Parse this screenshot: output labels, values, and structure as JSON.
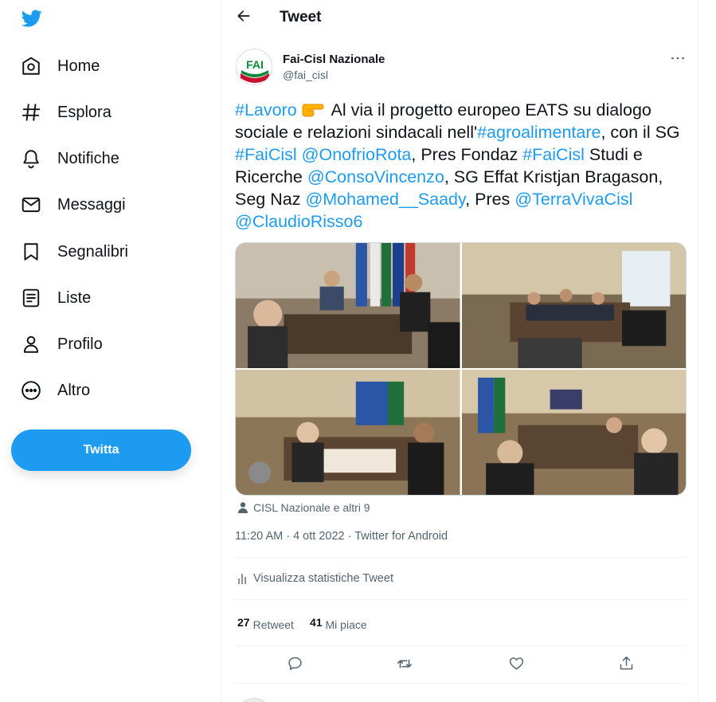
{
  "sidebar": {
    "items": [
      {
        "label": "Home",
        "icon": "home-icon"
      },
      {
        "label": "Esplora",
        "icon": "hashtag-icon"
      },
      {
        "label": "Notifiche",
        "icon": "bell-icon"
      },
      {
        "label": "Messaggi",
        "icon": "envelope-icon"
      },
      {
        "label": "Segnalibri",
        "icon": "bookmark-icon"
      },
      {
        "label": "Liste",
        "icon": "list-icon"
      },
      {
        "label": "Profilo",
        "icon": "person-icon"
      },
      {
        "label": "Altro",
        "icon": "more-circle-icon"
      }
    ],
    "tweet_button": "Twitta"
  },
  "header": {
    "title": "Tweet"
  },
  "tweet": {
    "author_name": "Fai-Cisl Nazionale",
    "author_handle": "@fai_cisl",
    "avatar_text": "FAI",
    "text": {
      "t1": "#Lavoro",
      "t2": " Al via il progetto europeo EATS su dialogo sociale e relazioni sindacali nell'",
      "t3": "#agroalimentare",
      "t4": ", con il SG ",
      "t5": "#FaiCisl",
      "t6": " ",
      "t7": "@OnofrioRota",
      "t8": ", Pres Fondaz ",
      "t9": "#FaiCisl",
      "t10": " Studi e Ricerche ",
      "t11": "@ConsoVincenzo",
      "t12": ", SG Effat Kristjan Bragason, Seg Naz ",
      "t13": "@Mohamed__Saady",
      "t14": ", Pres ",
      "t15": "@TerraVivaCisl",
      "t16": " ",
      "t17": "@ClaudioRisso6"
    },
    "tagged": "CISL Nazionale e altri 9",
    "time": "11:20 AM",
    "date": "4 ott 2022",
    "source": "Twitter for Android",
    "stats_link": "Visualizza statistiche Tweet",
    "retweets": {
      "count": "27",
      "label": "Retweet"
    },
    "likes": {
      "count": "41",
      "label": "Mi piace"
    }
  },
  "colors": {
    "accent": "#1d9bf0",
    "text": "#0f1419",
    "secondary": "#536471"
  }
}
